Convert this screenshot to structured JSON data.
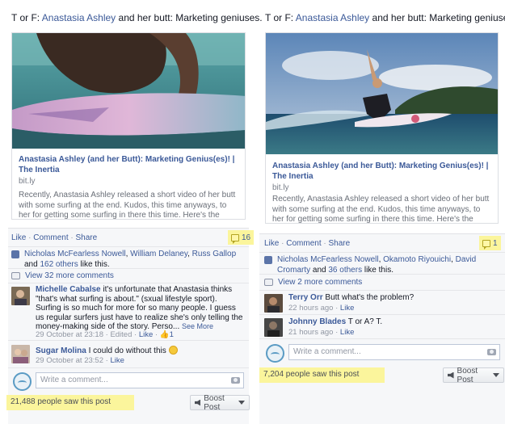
{
  "posts": [
    {
      "text_prefix": "T or F: ",
      "text_name": "Anastasia Ashley",
      "text_suffix": " and her butt: Marketing geniuses.",
      "link": {
        "title": "Anastasia Ashley (and her Butt): Marketing Genius(es)! | The Inertia",
        "domain": "bit.ly",
        "description": "Recently, Anastasia Ashley released a short video of her butt with some surfing at the end. Kudos, this time anyways, to her for getting some surfing in there this time. Here's the truth: butts"
      },
      "actions": {
        "like": "Like",
        "comment": "Comment",
        "share": "Share"
      },
      "comment_count": "16",
      "likes": {
        "names": [
          "Nicholas McFearless Nowell",
          "William Delaney",
          "Russ Gallop"
        ],
        "and": "and",
        "others": "162 others",
        "suffix": "like this."
      },
      "view_more": "View 32 more comments",
      "comments": [
        {
          "author": "Michelle Cabalse",
          "text": "it's unfortunate that Anastasia thinks \"that's what surfing is about.\" (sxual lifestyle sport). Surfing is so much for more for so many people. I guess us regular surfers just have to realize she's only telling the money-making side of the story. Perso...",
          "see_more": "See More",
          "time": "29 October at 23:18",
          "edited": "Edited",
          "like": "Like",
          "like_count": "1"
        },
        {
          "author": "Sugar Molina",
          "text": "I could do without this",
          "time": "29 October at 23:52",
          "like": "Like"
        }
      ],
      "write_placeholder": "Write a comment...",
      "seen": "21,488 people saw this post",
      "boost": "Boost Post"
    },
    {
      "text_prefix": "T or F: ",
      "text_name": "Anastasia Ashley",
      "text_suffix": " and her butt: Marketing geniuses.",
      "link": {
        "title": "Anastasia Ashley (and her Butt): Marketing Genius(es)! | The Inertia",
        "domain": "bit.ly",
        "description": "Recently, Anastasia Ashley released a short video of her butt with some surfing at the end. Kudos, this time anyways, to her for getting some surfing in there this time. Here's the truth: butts"
      },
      "actions": {
        "like": "Like",
        "comment": "Comment",
        "share": "Share"
      },
      "comment_count": "1",
      "likes": {
        "names": [
          "Nicholas McFearless Nowell",
          "Okamoto Riyouichi",
          "David Cromarty"
        ],
        "and": "and",
        "others": "36 others",
        "suffix": "like this."
      },
      "view_more": "View 2 more comments",
      "comments": [
        {
          "author": "Terry Orr",
          "text": "Butt what's the problem?",
          "time": "22 hours ago",
          "like": "Like"
        },
        {
          "author": "Johnny Blades",
          "text": "T or A? T.",
          "time": "21 hours ago",
          "like": "Like"
        }
      ],
      "write_placeholder": "Write a comment...",
      "seen": "7,204 people saw this post",
      "boost": "Boost Post"
    }
  ],
  "colors": {
    "link": "#3b5998",
    "highlight": "#fbf59c",
    "ufi_bg": "#f6f7f9"
  }
}
